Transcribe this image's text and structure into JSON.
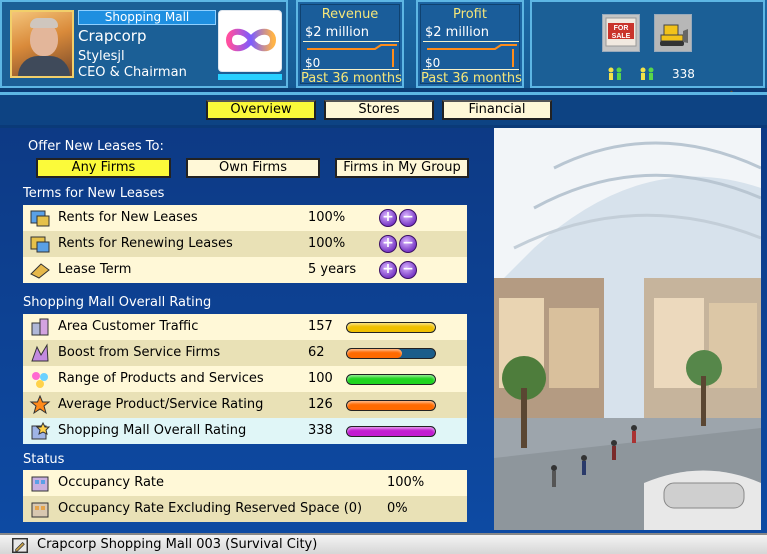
{
  "header": {
    "firm_type": "Shopping Mall",
    "corp_name": "Crapcorp",
    "ceo_name": "Stylesjl",
    "ceo_title": "CEO & Chairman",
    "revenue": {
      "title": "Revenue",
      "top_value": "$2 million",
      "zero_value": "$0",
      "period": "Past 36 months"
    },
    "profit": {
      "title": "Profit",
      "top_value": "$2 million",
      "zero_value": "$0",
      "period": "Past 36 months"
    },
    "population": "338"
  },
  "tabs": [
    {
      "label": "Overview",
      "active": true
    },
    {
      "label": "Stores",
      "active": false
    },
    {
      "label": "Financial",
      "active": false
    }
  ],
  "leases": {
    "offer_label": "Offer New Leases To:",
    "choices": [
      {
        "label": "Any Firms",
        "active": true
      },
      {
        "label": "Own Firms",
        "active": false
      },
      {
        "label": "Firms in My Group",
        "active": false
      }
    ],
    "terms_heading": "Terms for New Leases",
    "terms": [
      {
        "icon": "rent-new-icon",
        "label": "Rents for New Leases",
        "value": "100%"
      },
      {
        "icon": "rent-renew-icon",
        "label": "Rents for Renewing Leases",
        "value": "100%"
      },
      {
        "icon": "lease-term-icon",
        "label": "Lease Term",
        "value": "5 years"
      }
    ]
  },
  "rating": {
    "heading": "Shopping Mall Overall Rating",
    "rows": [
      {
        "icon": "customer-traffic-icon",
        "label": "Area Customer Traffic",
        "value": "157",
        "fill": 1.0,
        "color": "#f0c000"
      },
      {
        "icon": "service-firms-icon",
        "label": "Boost from Service Firms",
        "value": "62",
        "fill": 0.62,
        "color": "#ff6a00"
      },
      {
        "icon": "products-icon",
        "label": "Range of Products and Services",
        "value": "100",
        "fill": 1.0,
        "color": "#1fd41f"
      },
      {
        "icon": "product-rating-icon",
        "label": "Average Product/Service Rating",
        "value": "126",
        "fill": 1.0,
        "color": "#ff6a00"
      },
      {
        "icon": "overall-rating-icon",
        "label": "Shopping Mall Overall Rating",
        "value": "338",
        "fill": 1.0,
        "color": "#c21bd1"
      }
    ]
  },
  "status": {
    "heading": "Status",
    "rows": [
      {
        "icon": "occupancy-icon",
        "label": "Occupancy Rate",
        "value": "100%"
      },
      {
        "icon": "occupancy-excl-icon",
        "label": "Occupancy Rate Excluding Reserved Space (0)",
        "value": "0%"
      }
    ]
  },
  "status_bar": {
    "text": "Crapcorp Shopping Mall 003 (Survival City)"
  }
}
